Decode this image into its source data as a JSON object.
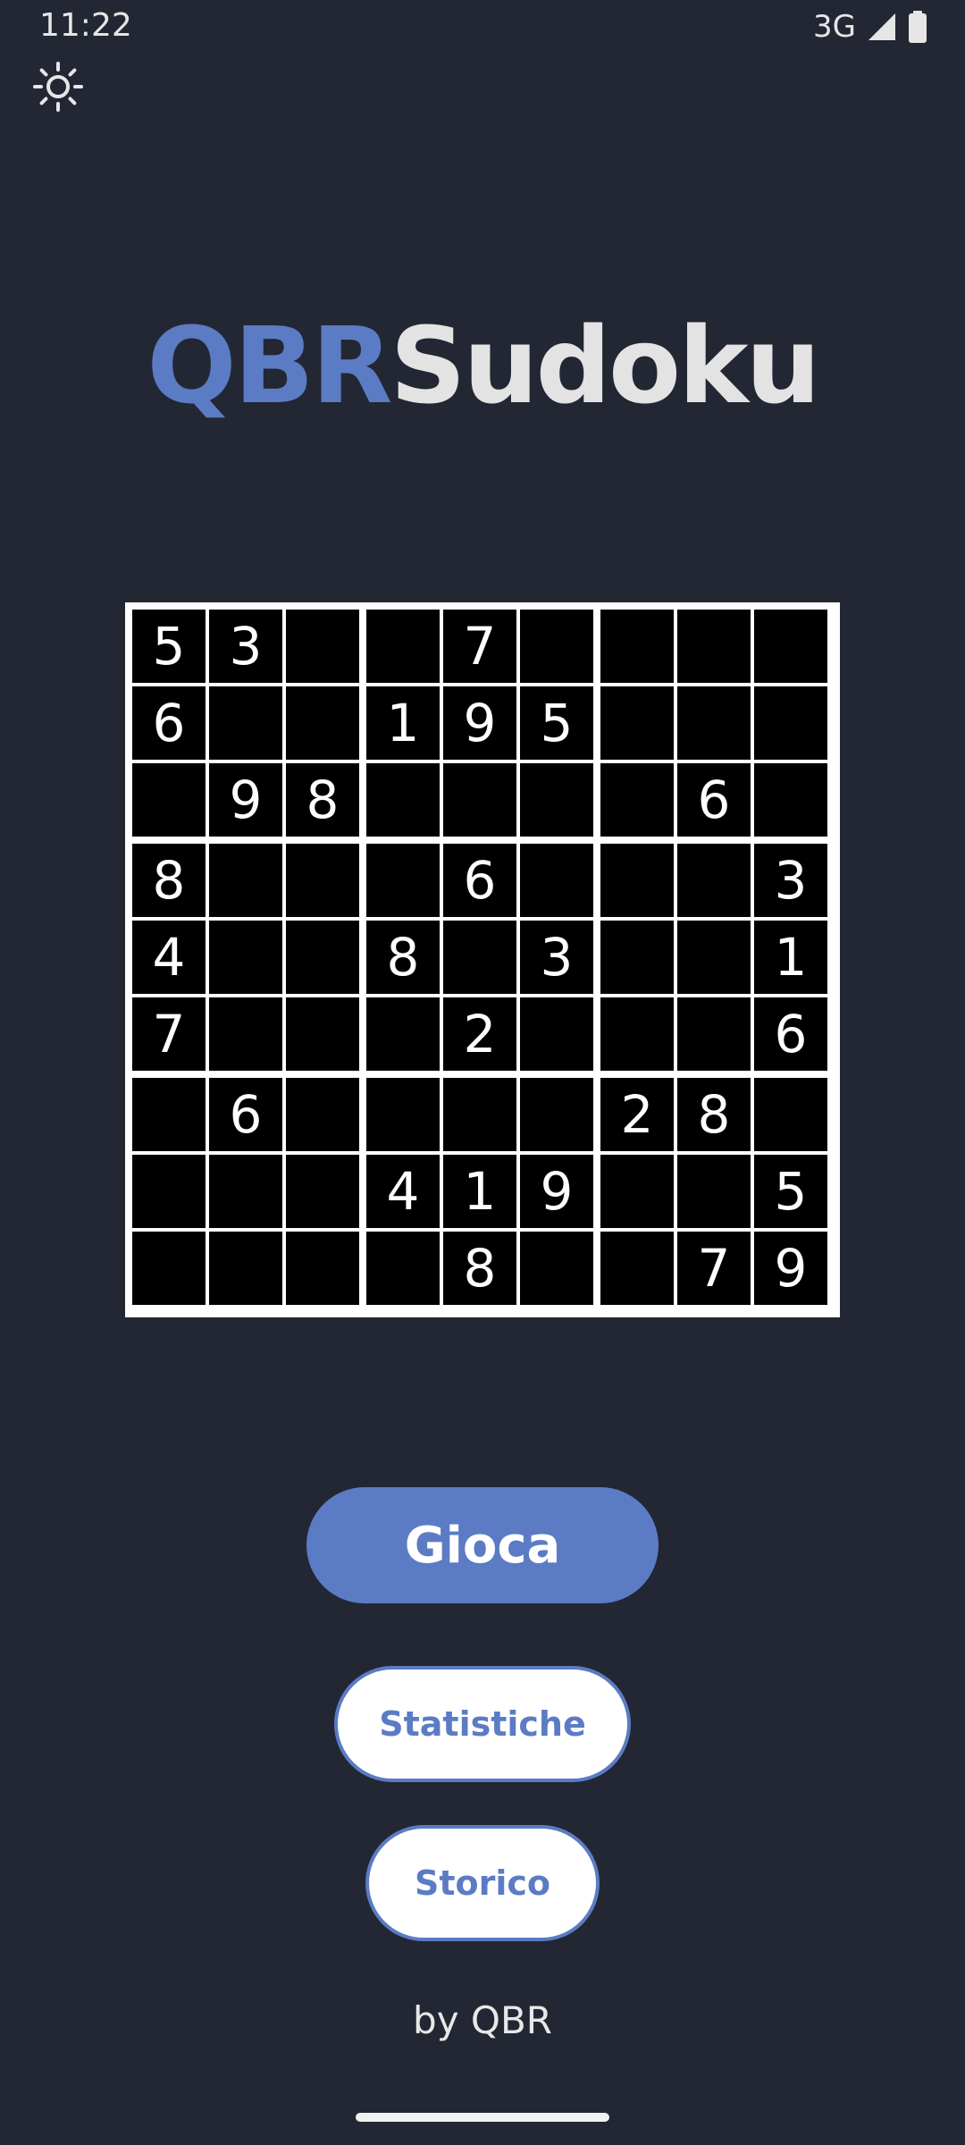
{
  "status_bar": {
    "time": "11:22",
    "network": "3G",
    "signal_icon": "signal-icon",
    "battery_icon": "battery-icon"
  },
  "theme_toggle": {
    "icon": "sun-icon"
  },
  "logo": {
    "part_a": "QBR",
    "part_b": "Sudoku",
    "color_a": "#5b7cc4",
    "color_b": "#e3e3e3"
  },
  "board": {
    "grid": [
      [
        "5",
        "3",
        "",
        "",
        "7",
        "",
        "",
        "",
        ""
      ],
      [
        "6",
        "",
        "",
        "1",
        "9",
        "5",
        "",
        "",
        ""
      ],
      [
        "",
        "9",
        "8",
        "",
        "",
        "",
        "",
        "6",
        ""
      ],
      [
        "8",
        "",
        "",
        "",
        "6",
        "",
        "",
        "",
        "3"
      ],
      [
        "4",
        "",
        "",
        "8",
        "",
        "3",
        "",
        "",
        "1"
      ],
      [
        "7",
        "",
        "",
        "",
        "2",
        "",
        "",
        "",
        "6"
      ],
      [
        "",
        "6",
        "",
        "",
        "",
        "",
        "2",
        "8",
        ""
      ],
      [
        "",
        "",
        "",
        "4",
        "1",
        "9",
        "",
        "",
        "5"
      ],
      [
        "",
        "",
        "",
        "",
        "8",
        "",
        "",
        "7",
        "9"
      ]
    ]
  },
  "buttons": {
    "play_label": "Gioca",
    "stats_label": "Statistiche",
    "history_label": "Storico"
  },
  "footer": {
    "text": "by QBR"
  },
  "colors": {
    "background": "#222733",
    "accent": "#5b7cc4"
  }
}
